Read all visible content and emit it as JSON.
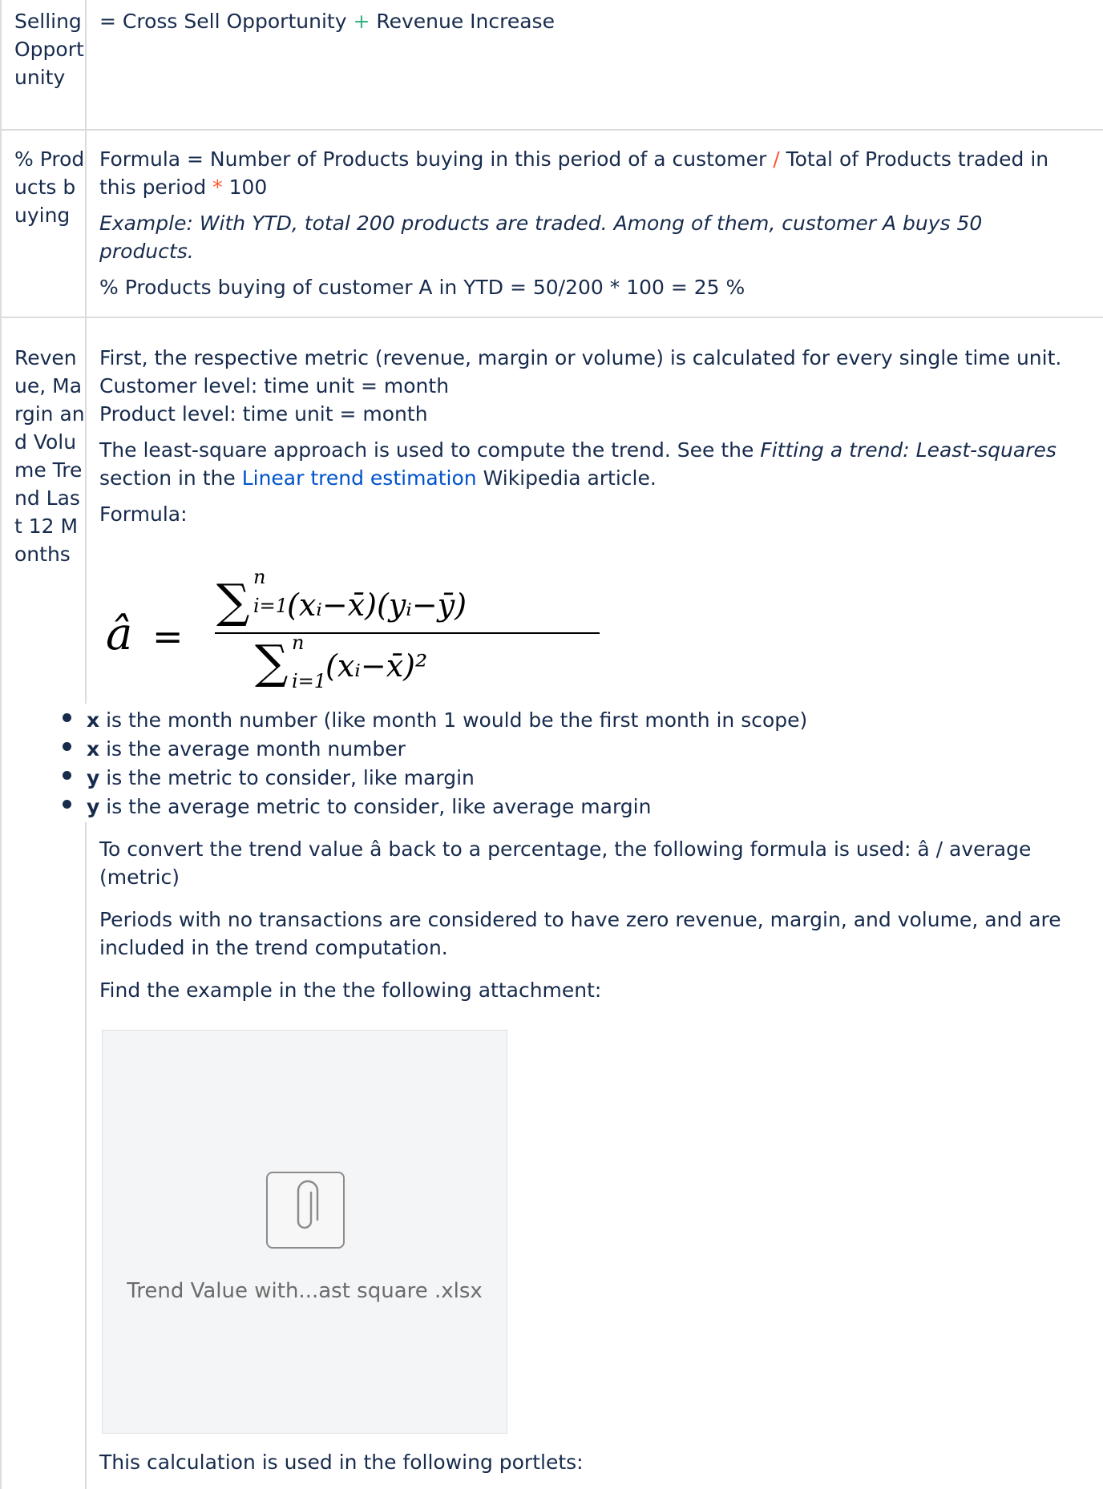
{
  "rows": [
    {
      "header": "Selling Opportunity",
      "formula_parts": [
        "= Cross Sell Opportunity ",
        "+",
        " Revenue Increase"
      ]
    },
    {
      "header": "% Products buying",
      "formula_parts": [
        "Formula = Number of Products buying in this period of a customer ",
        "/",
        " Total of Products traded in this period ",
        "*",
        " 100"
      ],
      "example": "Example: With YTD, total 200 products are traded. Among of them, customer A buys 50 products.",
      "result": "% Products buying of customer A in YTD = 50/200 * 100 = 25 %"
    },
    {
      "header": "Revenue, Margin and Volume Trend Last 12 Months",
      "para1_lines": [
        "First, the respective metric (revenue, margin or volume) is calculated for every single time unit.",
        "Customer level: time unit = month",
        "Product level: time unit = month"
      ],
      "para2_parts": [
        "The least-square approach is used to compute the trend. See the ",
        "Fitting a trend: Least-squares",
        " section in the ",
        "Linear trend estimation",
        " Wikipedia article."
      ],
      "formula_label": "Formula:",
      "formula": {
        "lhs": "â",
        "eq": "=",
        "sum_sym": "∑",
        "upper": "n",
        "lower": "i=1",
        "numerator": "(xᵢ−x̄)(yᵢ−ȳ)",
        "denominator": "(xᵢ−x̄)²"
      },
      "bullets": [
        {
          "term": "x",
          "text": " is the month number (like month 1 would be the first month in scope)"
        },
        {
          "term": "x",
          "text": " is the average month number"
        },
        {
          "term": "y",
          "text": " is the metric to consider, like margin"
        },
        {
          "term": "y",
          "text": " is the average metric to consider, like average margin"
        }
      ],
      "para3": "To convert the trend value â back to a percentage, the following formula is used: â / average (metric)",
      "para4": "Periods with no transactions are considered to have zero revenue, margin, and volume, and are included in the trend computation.",
      "para5": "Find the example in the the following attachment:",
      "attachment": {
        "filename": "Trend Value with...ast square .xlsx",
        "icon": "paperclip-icon"
      },
      "para6": "This calculation is used in the following portlets:"
    }
  ]
}
